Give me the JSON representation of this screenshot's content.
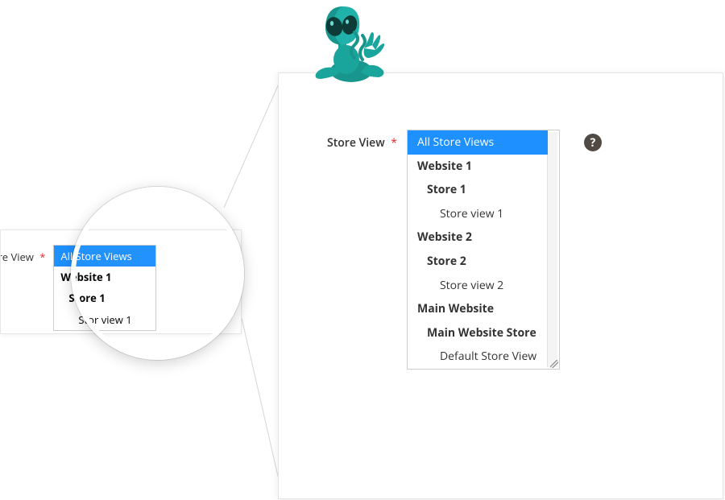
{
  "field": {
    "label": "Store View"
  },
  "dropdown": {
    "selected": "All Store Views",
    "groups": [
      {
        "website": "Website 1",
        "store": "Store 1",
        "view": "Store view 1"
      },
      {
        "website": "Website 2",
        "store": "Store 2",
        "view": "Store view 2"
      },
      {
        "website": "Main Website",
        "store": "Main Website Store",
        "view": "Default Store View"
      }
    ]
  },
  "help": {
    "glyph": "?"
  },
  "small": {
    "label": "tore View",
    "selected": "All Store Views",
    "groups": [
      {
        "website": "Website 1",
        "store": "Store 1",
        "view": "Stor   view 1"
      }
    ]
  }
}
